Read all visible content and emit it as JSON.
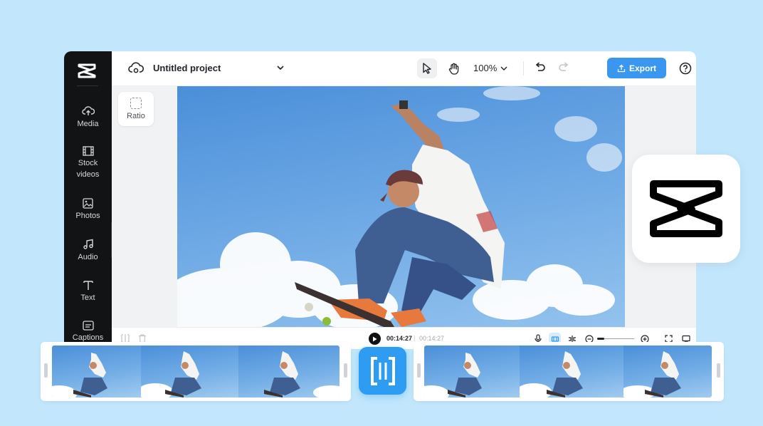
{
  "app": {
    "project_title": "Untitled project",
    "zoom_level": "100%",
    "export_label": "Export",
    "brand_color": "#3a97ef"
  },
  "sidebar": {
    "items": [
      {
        "label": "Media",
        "icon": "cloud-upload-icon"
      },
      {
        "label": "Stock videos",
        "icon": "film-icon"
      },
      {
        "label": "Photos",
        "icon": "image-icon"
      },
      {
        "label": "Audio",
        "icon": "music-note-icon"
      },
      {
        "label": "Text",
        "icon": "text-icon"
      },
      {
        "label": "Captions",
        "icon": "captions-icon"
      }
    ]
  },
  "canvas": {
    "ratio_label": "Ratio"
  },
  "timeline": {
    "current_time": "00:14:27",
    "separator": "|",
    "total_time": "00:14:27"
  }
}
